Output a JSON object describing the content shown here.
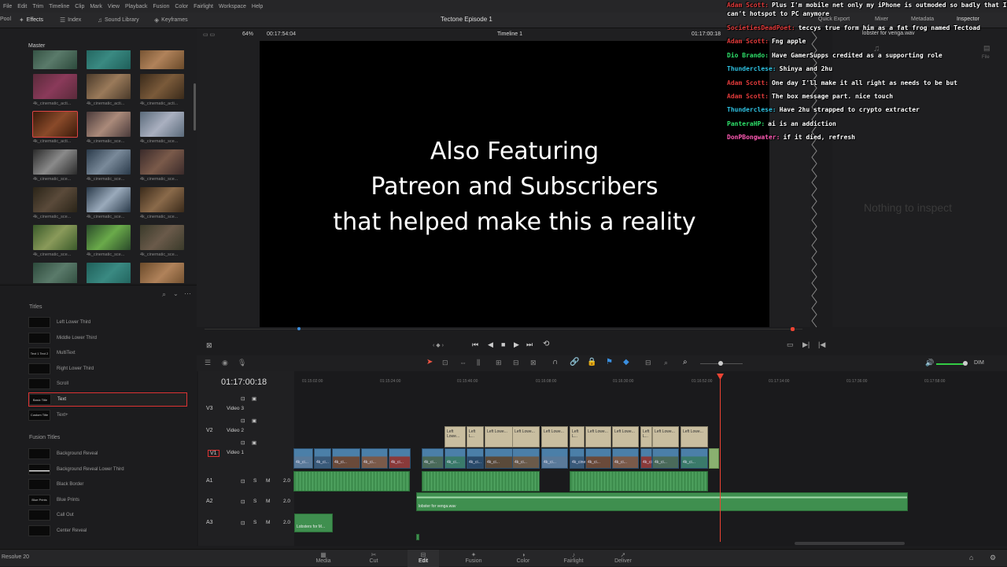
{
  "menu": [
    "File",
    "Edit",
    "Trim",
    "Timeline",
    "Clip",
    "Mark",
    "View",
    "Playback",
    "Fusion",
    "Color",
    "Fairlight",
    "Workspace",
    "Help"
  ],
  "toolbar": {
    "pool_label": "Pool",
    "effects_label": "Effects",
    "index_label": "Index",
    "sound_library_label": "Sound Library",
    "keyframes_label": "Keyframes",
    "project_title": "Tectone Episode 1",
    "quick_export_label": "Quick Export",
    "mixer_label": "Mixer",
    "metadata_label": "Metadata",
    "inspector_label": "Inspector"
  },
  "viewer": {
    "zoom": "64%",
    "source_timecode": "00:17:54:04",
    "timeline_name": "Timeline 1",
    "record_timecode": "01:17:00:18",
    "overlay_lines": [
      "Also Featuring",
      "Patreon and Subscribers",
      "that helped make this a reality"
    ]
  },
  "media_pool": {
    "bin": "Master",
    "thumb_labels": [
      "4k_cinematic_acti...",
      "4k_cinematic_acti...",
      "4k_cinematic_acti...",
      "4k_cinematic_acti...",
      "4k_cinematic_sce...",
      "4k_cinematic_sce...",
      "4k_cinematic_sce...",
      "4k_cinematic_sce...",
      "4k_cinematic_sce...",
      "4k_cinematic_sce...",
      "4k_cinematic_sce...",
      "4k_cinematic_sce...",
      "4k_cinematic_sce...",
      "4k_cinematic_sce...",
      "4k_cinematic_sce..."
    ]
  },
  "effects": {
    "titles_header": "Titles",
    "titles": [
      "Left Lower Third",
      "Middle Lower Third",
      "MultiText",
      "Right Lower Third",
      "Scroll",
      "Text",
      "Text+"
    ],
    "title_thumbs": [
      "",
      "",
      "Text 1 Text 2",
      "",
      "",
      "Basic Title",
      "Custom Title"
    ],
    "fusion_header": "Fusion Titles",
    "fusion_titles": [
      "Background Reveal",
      "Background Reveal Lower Third",
      "Black Border",
      "Blue Prints",
      "Call Out",
      "Center Reveal"
    ],
    "fusion_thumbs": [
      "",
      "",
      "",
      "Blue Prints",
      "",
      ""
    ]
  },
  "inspector": {
    "clip_name": "lobster for venga.wav",
    "empty_text": "Nothing to inspect",
    "file_label": "File"
  },
  "chat": [
    {
      "user": "Adam Scott:",
      "msg": "Plus I'm mobile net only my iPhone is outmoded so badly that I can't hotspot to PC anymore",
      "color": "#e03a3a"
    },
    {
      "user": "SocietiesDeadPoet:",
      "msg": "teccys true form him as a fat frog named Tectoad",
      "color": "#e03a3a"
    },
    {
      "user": "Adam Scott:",
      "msg": "Fng apple",
      "color": "#e03a3a"
    },
    {
      "user": "Dio Brando:",
      "msg": "Have GamerSupps credited as a supporting role",
      "color": "#2ee06a"
    },
    {
      "user": "Thunderclese:",
      "msg": "Shinya and 2hu",
      "color": "#2ec0e0"
    },
    {
      "user": "Adam Scott:",
      "msg": "One day I'll make it all right as needs to be but",
      "color": "#e03a3a"
    },
    {
      "user": "Adam Scott:",
      "msg": "The box message part. nice touch",
      "color": "#e03a3a"
    },
    {
      "user": "Thunderclese:",
      "msg": "Have 2hu strapped to crypto extracter",
      "color": "#2ec0e0"
    },
    {
      "user": "PanteraHP:",
      "msg": "ai is an addiction",
      "color": "#2ee06a"
    },
    {
      "user": "DonPBongwater:",
      "msg": "if it died, refresh",
      "color": "#ff5ab4"
    }
  ],
  "timeline": {
    "timecode": "01:17:00:18",
    "ruler": [
      "01:15:02:00",
      "01:15:24:00",
      "01:15:46:00",
      "01:16:08:00",
      "01:16:30:00",
      "01:16:52:00",
      "01:17:14:00",
      "01:17:36:00",
      "01:17:58:00"
    ],
    "tracks": [
      {
        "id": "V3",
        "name": "Video 3"
      },
      {
        "id": "V2",
        "name": "Video 2"
      },
      {
        "id": "V1",
        "name": "Video 1"
      },
      {
        "id": "A1",
        "name": "",
        "level": "2.0"
      },
      {
        "id": "A2",
        "name": "",
        "level": "2.0"
      },
      {
        "id": "A3",
        "name": "",
        "level": "2.0"
      }
    ],
    "title_clip_label": "Left L...",
    "title_clip_label_long": "Left Lowe...",
    "video_clip_label": "4k_ci...",
    "video_clip_label_long": "4k_cinem...",
    "audio_a2_label": "lobster for venga.wav",
    "audio_a3_label": "Lobsters for M...",
    "dim_label": "DIM"
  },
  "pages": [
    "Media",
    "Cut",
    "Edit",
    "Fusion",
    "Color",
    "Fairlight",
    "Deliver"
  ],
  "active_page": "Edit",
  "app_name": "Resolve 20"
}
